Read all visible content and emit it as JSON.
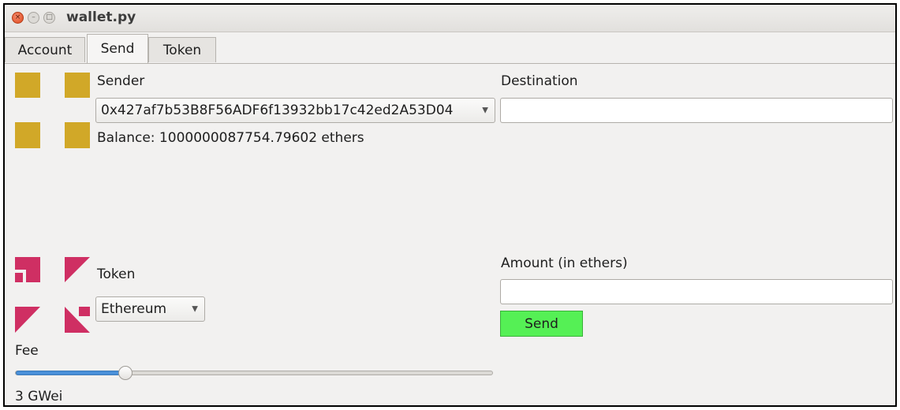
{
  "window": {
    "title": "wallet.py",
    "close_glyph": "×",
    "min_glyph": "–",
    "max_glyph": "□"
  },
  "tabs": [
    {
      "label": "Account",
      "active": false
    },
    {
      "label": "Send",
      "active": true
    },
    {
      "label": "Token",
      "active": false
    }
  ],
  "sender": {
    "label": "Sender",
    "selected_address": "0x427af7b53B8F56ADF6f13932bb17c42ed2A53D04",
    "balance_text": "Balance: 1000000087754.79602 ethers",
    "identicon_color": "#d1a828"
  },
  "destination": {
    "label": "Destination",
    "value": ""
  },
  "token": {
    "label": "Token",
    "selected": "Ethereum",
    "identicon_color": "#cf2f63"
  },
  "amount": {
    "label": "Amount (in ethers)",
    "value": ""
  },
  "send_button": {
    "label": "Send",
    "color": "#55f055"
  },
  "fee": {
    "label": "Fee",
    "value_text": "3 GWei",
    "slider_fraction": 0.23,
    "accent": "#4a90d9"
  }
}
